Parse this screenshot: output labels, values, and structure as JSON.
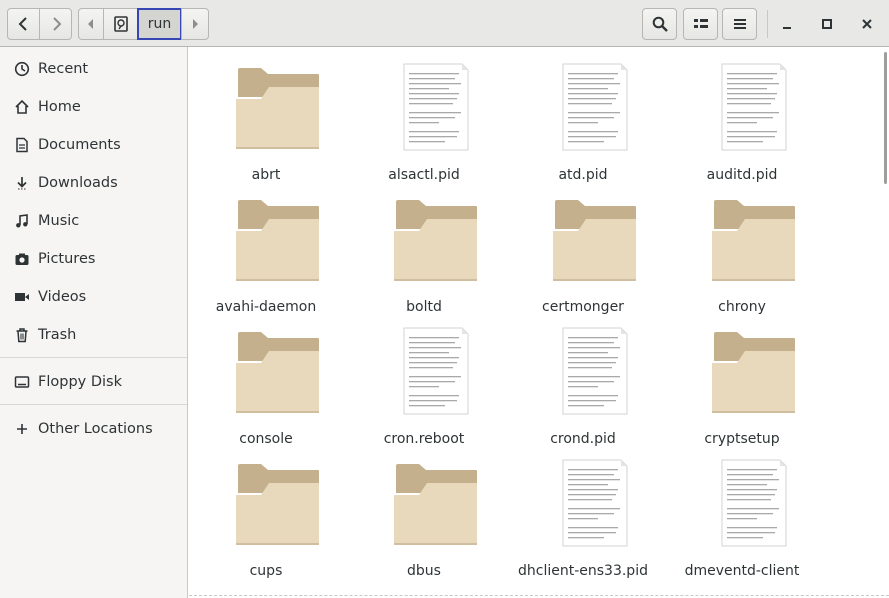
{
  "header": {
    "path_current": "run",
    "icons": [
      "go-back-icon",
      "go-forward-icon",
      "path-left-icon",
      "root-drive-icon",
      "path-right-icon",
      "search-icon",
      "view-toggle-icon",
      "hamburger-menu-icon",
      "minimize-icon",
      "maximize-icon",
      "close-icon"
    ]
  },
  "sidebar": {
    "items": [
      {
        "label": "Recent",
        "icon": "recent-icon"
      },
      {
        "label": "Home",
        "icon": "home-icon"
      },
      {
        "label": "Documents",
        "icon": "documents-icon"
      },
      {
        "label": "Downloads",
        "icon": "downloads-icon"
      },
      {
        "label": "Music",
        "icon": "music-icon"
      },
      {
        "label": "Pictures",
        "icon": "pictures-icon"
      },
      {
        "label": "Videos",
        "icon": "videos-icon"
      },
      {
        "label": "Trash",
        "icon": "trash-icon"
      }
    ],
    "devices": [
      {
        "label": "Floppy Disk",
        "icon": "floppy-disk-icon"
      }
    ],
    "other": {
      "label": "Other Locations",
      "icon": "plus-icon"
    }
  },
  "files": [
    {
      "name": "abrt",
      "type": "folder"
    },
    {
      "name": "alsactl.pid",
      "type": "file"
    },
    {
      "name": "atd.pid",
      "type": "file"
    },
    {
      "name": "auditd.pid",
      "type": "file"
    },
    {
      "name": "avahi-daemon",
      "type": "folder"
    },
    {
      "name": "boltd",
      "type": "folder"
    },
    {
      "name": "certmonger",
      "type": "folder"
    },
    {
      "name": "chrony",
      "type": "folder"
    },
    {
      "name": "console",
      "type": "folder"
    },
    {
      "name": "cron.reboot",
      "type": "file"
    },
    {
      "name": "crond.pid",
      "type": "file"
    },
    {
      "name": "cryptsetup",
      "type": "folder"
    },
    {
      "name": "cups",
      "type": "folder"
    },
    {
      "name": "dbus",
      "type": "folder"
    },
    {
      "name": "dhclient-ens33.pid",
      "type": "file"
    },
    {
      "name": "dmeventd-client",
      "type": "file"
    }
  ],
  "colors": {
    "folder_body": "#e8d9bd",
    "folder_tab": "#c4b08c",
    "selection_outline": "#3646b5"
  }
}
